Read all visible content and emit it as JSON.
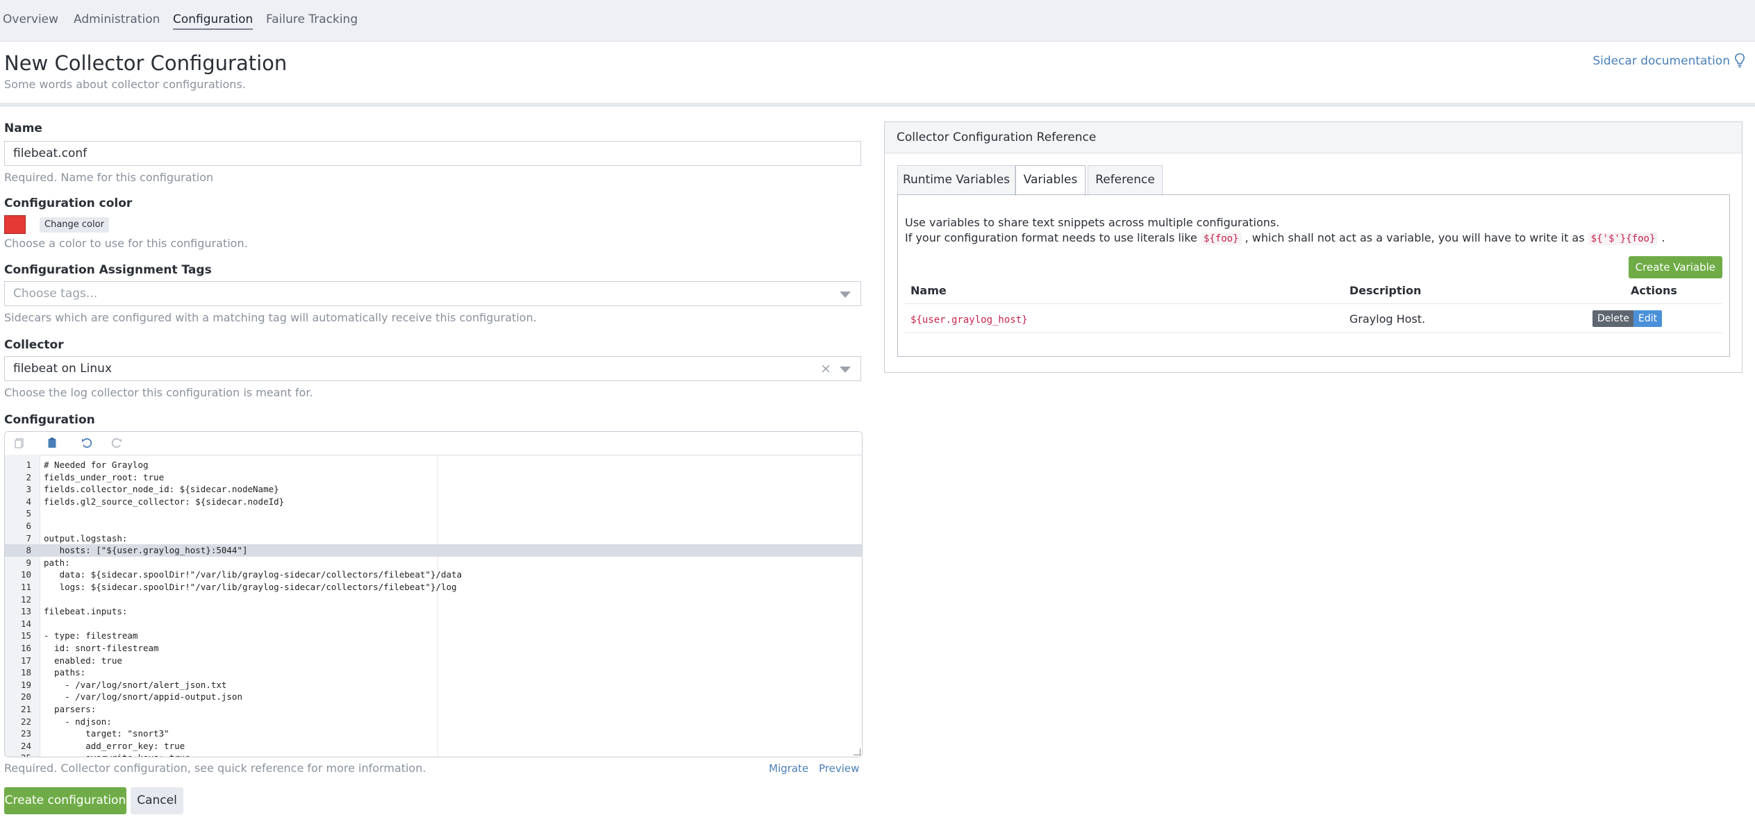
{
  "nav": {
    "items": [
      "Overview",
      "Administration",
      "Configuration",
      "Failure Tracking"
    ],
    "active_index": 2
  },
  "header": {
    "title": "New Collector Configuration",
    "subtitle": "Some words about collector configurations.",
    "doc_link": "Sidecar documentation"
  },
  "form": {
    "name": {
      "label": "Name",
      "value": "filebeat.conf",
      "help": "Required. Name for this configuration"
    },
    "color": {
      "label": "Configuration color",
      "value": "#e53935",
      "button": "Change color",
      "help": "Choose a color to use for this configuration."
    },
    "tags": {
      "label": "Configuration Assignment Tags",
      "placeholder": "Choose tags...",
      "help": "Sidecars which are configured with a matching tag will automatically receive this configuration."
    },
    "collector": {
      "label": "Collector",
      "value": "filebeat on Linux",
      "help": "Choose the log collector this configuration is meant for."
    },
    "configuration": {
      "label": "Configuration",
      "help": "Required. Collector configuration, see quick reference for more information.",
      "migrate": "Migrate",
      "preview": "Preview",
      "highlighted_line": 8,
      "lines": [
        "# Needed for Graylog",
        "fields_under_root: true",
        "fields.collector_node_id: ${sidecar.nodeName}",
        "fields.gl2_source_collector: ${sidecar.nodeId}",
        "",
        "",
        "output.logstash:",
        "   hosts: [\"${user.graylog_host}:5044\"]",
        "path:",
        "   data: ${sidecar.spoolDir!\"/var/lib/graylog-sidecar/collectors/filebeat\"}/data",
        "   logs: ${sidecar.spoolDir!\"/var/lib/graylog-sidecar/collectors/filebeat\"}/log",
        "",
        "filebeat.inputs:",
        "",
        "- type: filestream",
        "  id: snort-filestream",
        "  enabled: true",
        "  paths:",
        "    - /var/log/snort/alert_json.txt",
        "    - /var/log/snort/appid-output.json",
        "  parsers:",
        "    - ndjson:",
        "        target: \"snort3\"",
        "        add_error_key: true",
        "        overwrite_keys: true"
      ]
    },
    "submit": "Create configuration",
    "cancel": "Cancel"
  },
  "reference": {
    "title": "Collector Configuration Reference",
    "tabs": [
      "Runtime Variables",
      "Variables",
      "Reference"
    ],
    "active_tab": 1,
    "desc1": "Use variables to share text snippets across multiple configurations.",
    "desc2_a": "If your configuration format needs to use literals like",
    "desc2_code1": "${foo}",
    "desc2_b": ", which shall not act as a variable, you will have to write it as",
    "desc2_code2": "${'$'}{foo}",
    "desc2_c": ".",
    "create_button": "Create Variable",
    "columns": [
      "Name",
      "Description",
      "Actions"
    ],
    "rows": [
      {
        "name": "${user.graylog_host}",
        "description": "Graylog Host.",
        "delete": "Delete",
        "edit": "Edit"
      }
    ]
  }
}
